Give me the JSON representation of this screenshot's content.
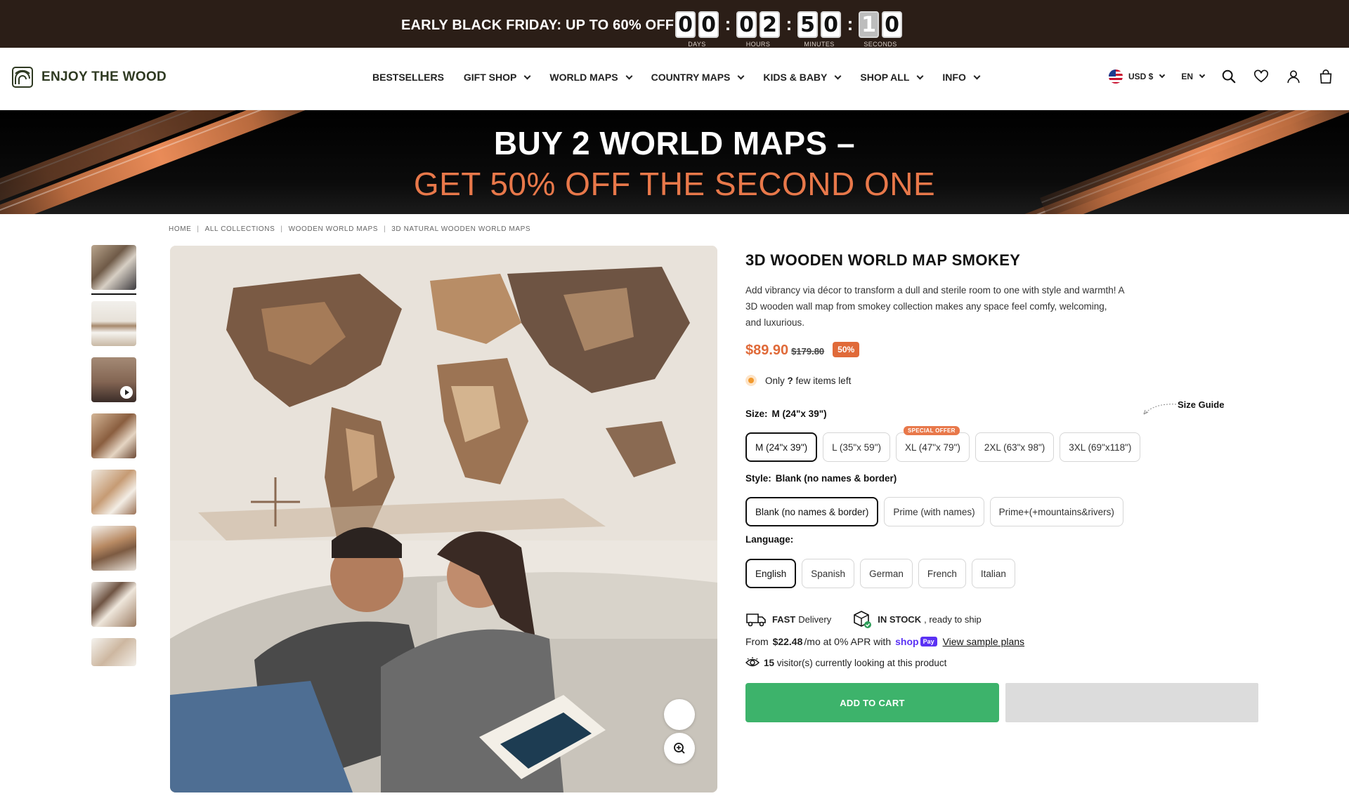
{
  "announcement": {
    "text": "EARLY BLACK FRIDAY:  UP TO 60% OFF",
    "countdown": [
      {
        "digits": [
          "0",
          "0"
        ],
        "label": "DAYS"
      },
      {
        "digits": [
          "0",
          "2"
        ],
        "label": "HOURS"
      },
      {
        "digits": [
          "5",
          "0"
        ],
        "label": "MINUTES"
      },
      {
        "digits": [
          "1",
          "0"
        ],
        "label": "SECONDS"
      }
    ],
    "separator": ":"
  },
  "header": {
    "brand": "ENJOY THE WOOD",
    "nav": [
      {
        "label": "BESTSELLERS",
        "dropdown": false
      },
      {
        "label": "GIFT SHOP",
        "dropdown": true
      },
      {
        "label": "WORLD MAPS",
        "dropdown": true
      },
      {
        "label": "COUNTRY MAPS",
        "dropdown": true
      },
      {
        "label": "KIDS & BABY",
        "dropdown": true
      },
      {
        "label": "SHOP ALL",
        "dropdown": true
      },
      {
        "label": "INFO",
        "dropdown": true
      }
    ],
    "currency": "USD $",
    "language": "EN",
    "icons": [
      "search-icon",
      "heart-icon",
      "user-icon",
      "bag-icon"
    ]
  },
  "banner": {
    "line1": "BUY 2 WORLD MAPS –",
    "line2": "GET 50% OFF THE SECOND ONE",
    "accent_color": "#e8784a"
  },
  "breadcrumb": [
    "HOME",
    "ALL COLLECTIONS",
    "WOODEN WORLD MAPS",
    "3D NATURAL WOODEN WORLD MAPS"
  ],
  "product": {
    "title": "3D WOODEN WORLD MAP SMOKEY",
    "description": "Add vibrancy via décor to transform a dull and sterile room to one with style and warmth! A 3D wooden wall map from smokey collection makes any space feel comfy, welcoming, and luxurious.",
    "price": "$89.90",
    "compare_price": "$179.80",
    "discount_badge": "50%",
    "stock_prefix": "Only",
    "stock_count": "?",
    "stock_suffix": "few items left",
    "size": {
      "label": "Size:",
      "selected": "M (24\"x 39\")",
      "guide": "Size Guide",
      "options": [
        "M (24\"x 39\")",
        "L (35\"x 59\")",
        "XL (47\"x 79\")",
        "2XL (63\"x 98\")",
        "3XL (69\"x118\")"
      ],
      "special_tag": "SPECIAL OFFER"
    },
    "style": {
      "label": "Style:",
      "selected": "Blank (no names & border)",
      "options": [
        "Blank (no names & border)",
        "Prime (with names)",
        "Prime+(+mountains&rivers)"
      ]
    },
    "language": {
      "label": "Language:",
      "options": [
        "English",
        "Spanish",
        "German",
        "French",
        "Italian"
      ]
    },
    "delivery_bold": "FAST",
    "delivery_text": "Delivery",
    "instock_bold": "IN STOCK",
    "instock_text": ", ready to ship",
    "apr_prefix": "From",
    "apr_amount": "$22.48",
    "apr_suffix": "/mo at 0% APR with",
    "shop_text": "shop",
    "pay_text": "Pay",
    "view_plans": "View sample plans",
    "viewers_count": "15",
    "viewers_text": "visitor(s) currently looking at this product",
    "add_to_cart": "ADD TO CART",
    "brand_green": "#3db36b",
    "price_color": "#e06a39"
  },
  "gallery": {
    "thumbnails": 8,
    "video_thumb_index": 2
  }
}
